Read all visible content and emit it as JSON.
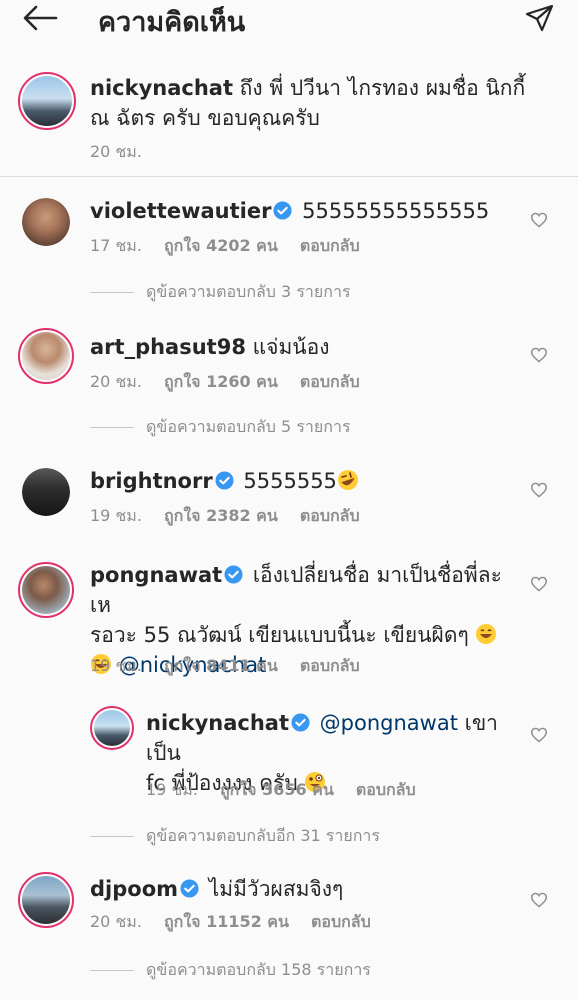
{
  "header": {
    "title": "ความคิดเห็น"
  },
  "caption": {
    "username": "nickynachat",
    "text": "ถึง พี่ ปวีนา ไกรทอง ผมชื่อ นิกกี้ ณ ฉัตร ครับ ขอบคุณครับ",
    "time": "20 ชม."
  },
  "comments": [
    {
      "username": "violettewautier",
      "text": "55555555555555",
      "time": "17 ชม.",
      "likes": "ถูกใจ 4202 คน",
      "reply": "ตอบกลับ",
      "view_replies": "ดูข้อความตอบกลับ 3 รายการ"
    },
    {
      "username": "art_phasut98",
      "text": "แจ่มน้อง",
      "time": "20 ชม.",
      "likes": "ถูกใจ 1260 คน",
      "reply": "ตอบกลับ",
      "view_replies": "ดูข้อความตอบกลับ 5 รายการ"
    },
    {
      "username": "brightnorr",
      "text": "5555555",
      "time": "19 ชม.",
      "likes": "ถูกใจ 2382 คน",
      "reply": "ตอบกลับ"
    },
    {
      "username": "pongnawat",
      "text_line1": "เอ็งเปลี่ยนชื่อ มาเป็นชื่อพี่ละเห",
      "text_line2": "รอวะ 55 ณวัฒน์ เขียนแบบนี้นะ เขียนผิดๆ",
      "mention": "@nickynachat",
      "time": "19 ชม.",
      "likes": "ถูกใจ 8411 คน",
      "reply": "ตอบกลับ"
    },
    {
      "username": "nickynachat",
      "mention": "@pongnawat",
      "text_tail": "เขาเป็น",
      "text_line2": "fc พี่ป้องงงง ครับ",
      "time": "19 ชม.",
      "likes": "ถูกใจ 3656 คน",
      "reply": "ตอบกลับ",
      "view_replies": "ดูข้อความตอบกลับอีก 31 รายการ"
    },
    {
      "username": "djpoom",
      "text": "ไม่มีวัวผสมจิงๆ",
      "time": "20 ชม.",
      "likes": "ถูกใจ 11152 คน",
      "reply": "ตอบกลับ",
      "view_replies": "ดูข้อความตอบกลับ 158 รายการ"
    }
  ],
  "colors": {
    "verified": "#3897f0",
    "ring": "#e1306c",
    "mention": "#00376b",
    "meta": "#8e8e8e"
  },
  "icons": {
    "back": "arrow-left-icon",
    "send": "paper-plane-icon",
    "like": "heart-outline-icon",
    "verified": "verified-badge-icon"
  }
}
